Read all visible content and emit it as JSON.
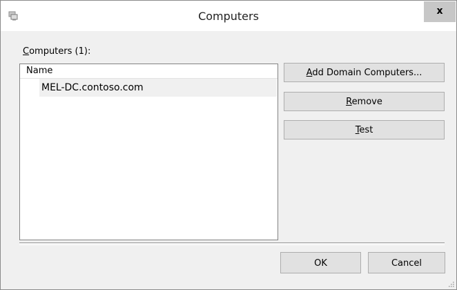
{
  "window": {
    "title": "Computers",
    "close_glyph": "x"
  },
  "list": {
    "label_mnemonic": "C",
    "label_rest": "omputers (1):",
    "column_header": "Name",
    "rows": [
      "MEL-DC.contoso.com"
    ]
  },
  "buttons": {
    "add_mnemonic": "A",
    "add_rest": "dd Domain Computers...",
    "remove_mnemonic": "R",
    "remove_rest": "emove",
    "test_mnemonic": "T",
    "test_rest": "est",
    "ok": "OK",
    "cancel": "Cancel"
  },
  "icons": {
    "app": "computers-dialog-icon",
    "close": "close-icon",
    "grip": "resize-grip-icon"
  },
  "colors": {
    "titlebar": "#ffffff",
    "client": "#f0f0f0",
    "close_button": "#c7c7c7",
    "button_face": "#e1e1e1"
  }
}
